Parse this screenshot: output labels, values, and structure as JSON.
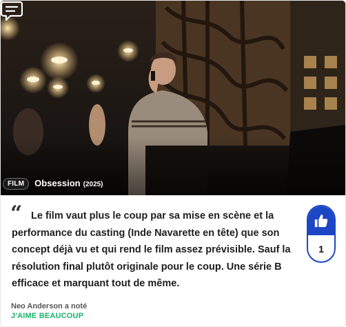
{
  "media": {
    "badge": "FILM",
    "title": "Obsession",
    "year": "(2025)"
  },
  "review": {
    "text": "Le film vaut plus le coup par sa mise en scène et la performance du casting (Inde Navarette en tête) que son concept déjà vu et qui rend le film assez prévisible. Sauf la résolution final plutôt originale pour le coup. Une série B efficace et marquant tout de même."
  },
  "like": {
    "count": "1",
    "color": "#1d46c4"
  },
  "footer": {
    "author": "Neo Anderson a noté",
    "rating": "J'AIME BEAUCOUP",
    "rating_color": "#18b36a"
  },
  "icons": [
    "comment-icon",
    "quote-icon",
    "thumbs-up-icon"
  ]
}
